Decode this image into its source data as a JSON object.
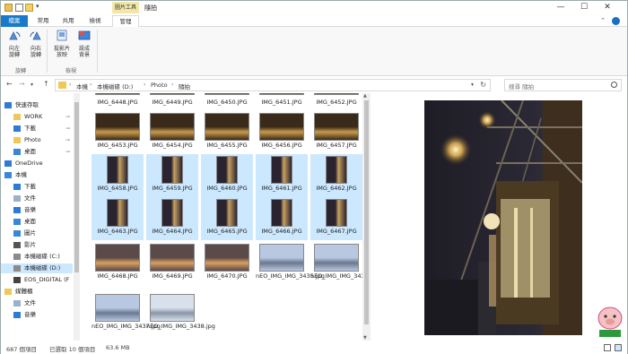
{
  "titlebar": {
    "context_tab": "圖片工具",
    "title": "隨拍",
    "min": "—",
    "max": "☐",
    "close": "✕"
  },
  "tabs": {
    "file": "檔案",
    "home": "常用",
    "share": "共用",
    "view": "檢視",
    "manage": "管理",
    "chevron": "⌃",
    "help": "?"
  },
  "ribbon": {
    "rotate_left": "向左\n旋轉",
    "rotate_left_1": "向左",
    "rotate_left_2": "旋轉",
    "rotate_right_1": "向右",
    "rotate_right_2": "旋轉",
    "slideshow_1": "投影片",
    "slideshow_2": "放映",
    "setbg_1": "設成",
    "setbg_2": "背景",
    "group_rotate": "旋轉",
    "group_view": "檢視"
  },
  "address": {
    "crumbs": [
      "本機",
      "本機磁碟 (D:)",
      "Photo",
      "隨拍"
    ],
    "sep": "›",
    "search_placeholder": "搜尋 隨拍"
  },
  "nav": {
    "items": [
      {
        "label": "快速存取",
        "icon": "star-icon",
        "pinned": false
      },
      {
        "label": "WORK",
        "icon": "folder-icon",
        "pinned": true
      },
      {
        "label": "下載",
        "icon": "download-icon",
        "pinned": true
      },
      {
        "label": "Photo",
        "icon": "folder-icon",
        "pinned": true
      },
      {
        "label": "桌面",
        "icon": "desktop-icon",
        "pinned": true
      },
      {
        "label": "OneDrive",
        "icon": "cloud-icon",
        "pinned": false
      },
      {
        "label": "本機",
        "icon": "computer-icon",
        "pinned": false
      },
      {
        "label": "下載",
        "icon": "download-icon",
        "pinned": false
      },
      {
        "label": "文件",
        "icon": "document-icon",
        "pinned": false
      },
      {
        "label": "音樂",
        "icon": "music-icon",
        "pinned": false
      },
      {
        "label": "桌面",
        "icon": "desktop-icon",
        "pinned": false
      },
      {
        "label": "圖片",
        "icon": "picture-icon",
        "pinned": false
      },
      {
        "label": "影片",
        "icon": "video-icon",
        "pinned": false
      },
      {
        "label": "本機磁碟 (C:)",
        "icon": "drive-icon",
        "pinned": false
      },
      {
        "label": "本機磁碟 (D:)",
        "icon": "drive-icon",
        "pinned": false
      },
      {
        "label": "EOS_DIGITAL (F",
        "icon": "sdcard-icon",
        "pinned": false
      },
      {
        "label": "媒體櫃",
        "icon": "library-icon",
        "pinned": false
      },
      {
        "label": "文件",
        "icon": "document-icon",
        "pinned": false
      },
      {
        "label": "音樂",
        "icon": "music-icon",
        "pinned": false
      }
    ],
    "pin": "📌"
  },
  "files": [
    {
      "name": "IMG_6448.JPG",
      "selected": false,
      "kind": "night-wide"
    },
    {
      "name": "IMG_6449.JPG",
      "selected": false,
      "kind": "night-wide"
    },
    {
      "name": "IMG_6450.JPG",
      "selected": false,
      "kind": "night-wide"
    },
    {
      "name": "IMG_6451.JPG",
      "selected": false,
      "kind": "night-wide"
    },
    {
      "name": "IMG_6452.JPG",
      "selected": false,
      "kind": "night-wide"
    },
    {
      "name": "IMG_6453.JPG",
      "selected": false,
      "kind": "night-wide"
    },
    {
      "name": "IMG_6454.JPG",
      "selected": false,
      "kind": "night-wide"
    },
    {
      "name": "IMG_6455.JPG",
      "selected": false,
      "kind": "night-wide"
    },
    {
      "name": "IMG_6456.JPG",
      "selected": false,
      "kind": "night-wide"
    },
    {
      "name": "IMG_6457.JPG",
      "selected": false,
      "kind": "night-wide"
    },
    {
      "name": "IMG_6458.JPG",
      "selected": true,
      "kind": "night-tall"
    },
    {
      "name": "IMG_6459.JPG",
      "selected": true,
      "kind": "night-tall"
    },
    {
      "name": "IMG_6460.JPG",
      "selected": true,
      "kind": "night-tall"
    },
    {
      "name": "IMG_6461.JPG",
      "selected": true,
      "kind": "night-tall"
    },
    {
      "name": "IMG_6462.JPG",
      "selected": true,
      "kind": "night-tall"
    },
    {
      "name": "IMG_6463.JPG",
      "selected": true,
      "kind": "night-tall"
    },
    {
      "name": "IMG_6464.JPG",
      "selected": true,
      "kind": "night-tall"
    },
    {
      "name": "IMG_6465.JPG",
      "selected": true,
      "kind": "night-tall"
    },
    {
      "name": "IMG_6466.JPG",
      "selected": true,
      "kind": "night-tall"
    },
    {
      "name": "IMG_6467.JPG",
      "selected": true,
      "kind": "night-tall"
    },
    {
      "name": "IMG_6468.JPG",
      "selected": false,
      "kind": "dusk-wide"
    },
    {
      "name": "IMG_6469.JPG",
      "selected": false,
      "kind": "dusk-wide"
    },
    {
      "name": "IMG_6470.JPG",
      "selected": false,
      "kind": "dusk-wide"
    },
    {
      "name": "nEO_IMG_IMG_3435.jpg",
      "selected": false,
      "kind": "sky-wide"
    },
    {
      "name": "nEO_IMG_IMG_3436.jpg",
      "selected": false,
      "kind": "sky-wide"
    },
    {
      "name": "nEO_IMG_IMG_3437.jpg",
      "selected": false,
      "kind": "sky-wide"
    },
    {
      "name": "nEO_IMG_IMG_3438.jpg",
      "selected": false,
      "kind": "sky-pale"
    }
  ],
  "status": {
    "count": "687 個項目",
    "selected": "已選取 10 個項目",
    "size": "63.6 MB"
  },
  "colors": {
    "selection": "#cce8ff",
    "accent": "#1979ca",
    "context_tab": "#f3e7a7"
  }
}
